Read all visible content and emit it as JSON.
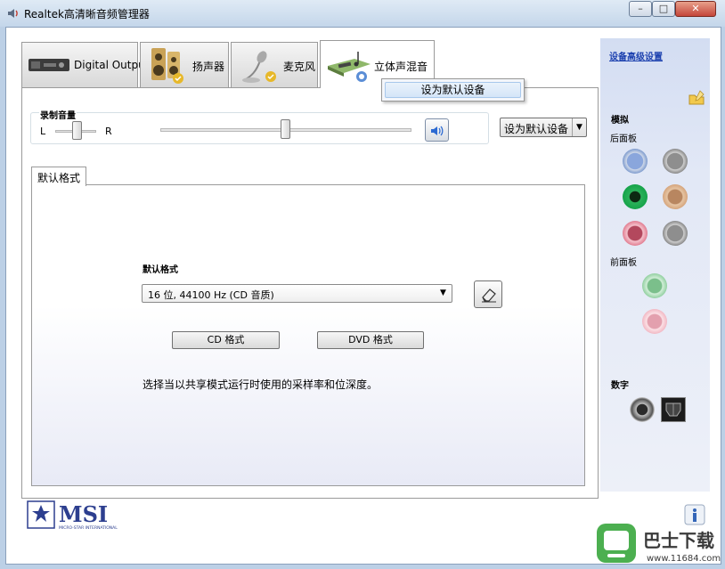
{
  "window": {
    "title": "Realtek高清晰音频管理器",
    "minimize": "–",
    "maximize": "□",
    "close": "✕"
  },
  "tabs": [
    {
      "label": "Digital Output",
      "icon": "digital-output-icon"
    },
    {
      "label": "扬声器",
      "icon": "speaker-icon"
    },
    {
      "label": "麦克风",
      "icon": "microphone-icon"
    },
    {
      "label": "立体声混音",
      "icon": "stereo-mix-icon",
      "active": true
    }
  ],
  "context_menu": {
    "item": "设为默认设备"
  },
  "recording_volume": {
    "label": "录制音量",
    "left": "L",
    "right": "R",
    "balance": 0.5,
    "level": 0.5
  },
  "default_device_dropdown": {
    "label": "设为默认设备",
    "arrow": "▼"
  },
  "format": {
    "tab": "默认格式",
    "title": "默认格式",
    "selected": "16 位, 44100 Hz (CD 音质)",
    "arrow": "▼",
    "cd_button": "CD 格式",
    "dvd_button": "DVD 格式",
    "description": "选择当以共享模式运行时使用的采样率和位深度。"
  },
  "side_panel": {
    "advanced_link": "设备高级设置",
    "analog": "模拟",
    "rear_panel": "后面板",
    "front_panel": "前面板",
    "digital": "数字"
  },
  "jack_colors": {
    "blue": "#6e8fc9",
    "gray": "#8e8e8e",
    "green": "#16a34a",
    "orange": "#d4a37a",
    "pink": "#e07a8e",
    "front_green": "#8fce9e",
    "front_pink": "#f1b6c2"
  },
  "branding": {
    "logo_text": "MSI",
    "logo_sub": "MICRO-STAR INTERNATIONAL",
    "watermark_text": "巴士下载",
    "watermark_url": "www.11684.com"
  }
}
